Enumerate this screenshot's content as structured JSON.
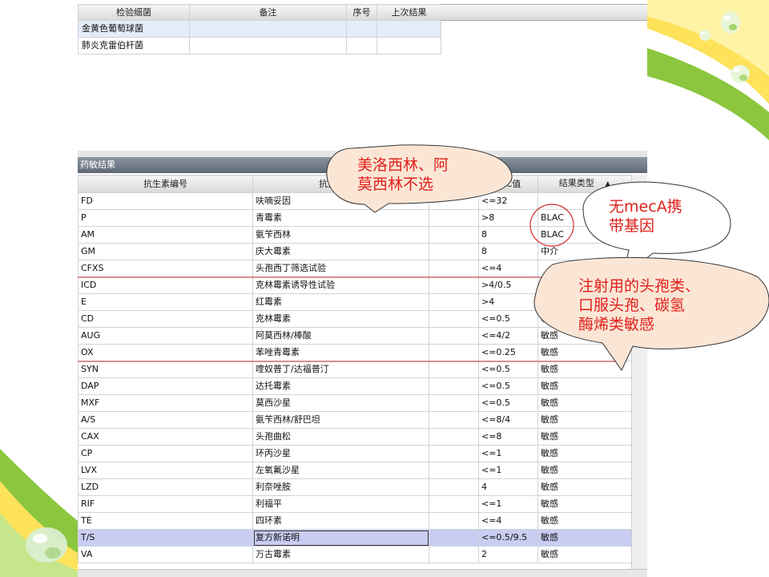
{
  "top_table": {
    "headers": [
      "检验细菌",
      "备注",
      "序号",
      "上次结果"
    ],
    "rows": [
      {
        "bacteria": "金黄色葡萄球菌",
        "note": "",
        "seq": "",
        "last": ""
      },
      {
        "bacteria": "肺炎克雷伯杆菌",
        "note": "",
        "seq": "",
        "last": ""
      }
    ]
  },
  "section_title": "药敏结果",
  "main_table": {
    "headers": [
      "抗生素编号",
      "抗生素名称",
      "",
      "MIC值",
      "结果类型"
    ],
    "sort_icon": "▲",
    "rows": [
      {
        "code": "FD",
        "name": "呋喃妥因",
        "mic": "<=32",
        "type": ""
      },
      {
        "code": "P",
        "name": "青霉素",
        "mic": ">8",
        "type": "BLAC"
      },
      {
        "code": "AM",
        "name": "氨苄西林",
        "mic": "8",
        "type": "BLAC"
      },
      {
        "code": "GM",
        "name": "庆大霉素",
        "mic": "8",
        "type": "中介"
      },
      {
        "code": "CFXS",
        "name": "头孢西丁筛选试验",
        "mic": "<=4",
        "type": ""
      },
      {
        "code": "ICD",
        "name": "克林霉素诱导性试验",
        "mic": ">4/0.5",
        "type": ""
      },
      {
        "code": "E",
        "name": "红霉素",
        "mic": ">4",
        "type": ""
      },
      {
        "code": "CD",
        "name": "克林霉素",
        "mic": "<=0.5",
        "type": "敏感"
      },
      {
        "code": "AUG",
        "name": "阿莫西林/棒酸",
        "mic": "<=4/2",
        "type": "敏感"
      },
      {
        "code": "OX",
        "name": "苯唑青霉素",
        "mic": "<=0.25",
        "type": "敏感"
      },
      {
        "code": "SYN",
        "name": "喹奴普丁/达福普汀",
        "mic": "<=0.5",
        "type": "敏感"
      },
      {
        "code": "DAP",
        "name": "达托霉素",
        "mic": "<=0.5",
        "type": "敏感"
      },
      {
        "code": "MXF",
        "name": "莫西沙星",
        "mic": "<=0.5",
        "type": "敏感"
      },
      {
        "code": "A/S",
        "name": "氨苄西林/舒巴坦",
        "mic": "<=8/4",
        "type": "敏感"
      },
      {
        "code": "CAX",
        "name": "头孢曲松",
        "mic": "<=8",
        "type": "敏感"
      },
      {
        "code": "CP",
        "name": "环丙沙星",
        "mic": "<=1",
        "type": "敏感"
      },
      {
        "code": "LVX",
        "name": "左氧氟沙星",
        "mic": "<=1",
        "type": "敏感"
      },
      {
        "code": "LZD",
        "name": "利奈唑胺",
        "mic": "4",
        "type": "敏感"
      },
      {
        "code": "RIF",
        "name": "利福平",
        "mic": "<=1",
        "type": "敏感"
      },
      {
        "code": "TE",
        "name": "四环素",
        "mic": "<=4",
        "type": "敏感"
      },
      {
        "code": "T/S",
        "name": "复方新诺明",
        "mic": "<=0.5/9.5",
        "type": "敏感"
      },
      {
        "code": "VA",
        "name": "万古霉素",
        "mic": "2",
        "type": "敏感"
      }
    ]
  },
  "annotations": {
    "callout_1": [
      "美洛西林、阿",
      "莫西林不选"
    ],
    "callout_2": [
      "无mecA携",
      "带基因"
    ],
    "callout_3": [
      "注射用的头孢类、",
      "口服头孢、碳氢",
      "酶烯类敏感"
    ]
  },
  "colors": {
    "annotation_red": "#e0201b",
    "selected_row": "#c9cdf2",
    "section_bar": "#6b7482",
    "deco_green": "#8cc63f",
    "deco_yellow": "#fde25a"
  }
}
